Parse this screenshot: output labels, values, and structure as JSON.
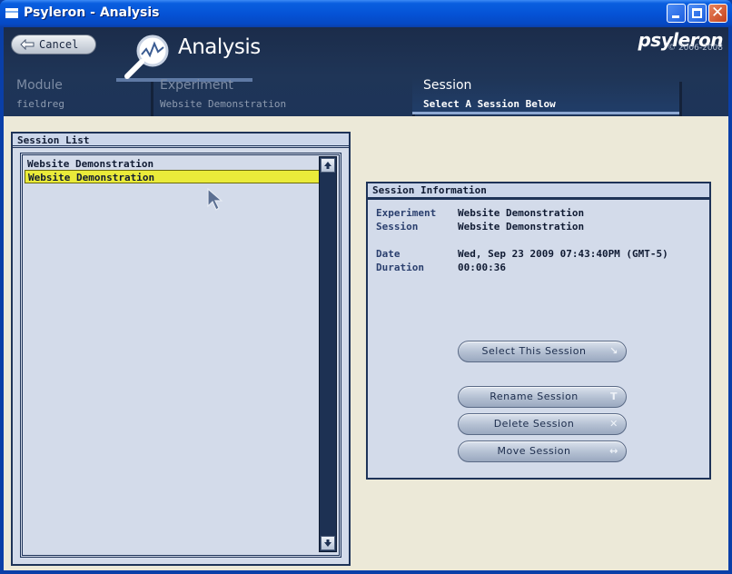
{
  "window": {
    "title": "Psyleron - Analysis"
  },
  "header": {
    "cancel_label": "Cancel",
    "title": "Analysis",
    "brand": "psyleron",
    "copyright": "© 2006-2008"
  },
  "breadcrumbs": [
    {
      "name": "Module",
      "value": "fieldreg"
    },
    {
      "name": "Experiment",
      "value": "Website Demonstration"
    },
    {
      "name": "Session",
      "value": "Select A Session Below"
    }
  ],
  "session_list": {
    "title": "Session List",
    "items": [
      {
        "label": "Website Demonstration",
        "selected": false
      },
      {
        "label": "Website Demonstration",
        "selected": true
      }
    ]
  },
  "session_info": {
    "title": "Session Information",
    "fields": [
      {
        "key": "Experiment",
        "value": "Website Demonstration"
      },
      {
        "key": "Session",
        "value": "Website Demonstration"
      },
      {
        "key": "Date",
        "value": "Wed, Sep 23 2009 07:43:40PM (GMT-5)"
      },
      {
        "key": "Duration",
        "value": "00:00:36"
      }
    ],
    "buttons": {
      "select": {
        "label": "Select This Session",
        "icon": "arrow-corner-icon"
      },
      "rename": {
        "label": "Rename Session",
        "icon": "text-t-icon"
      },
      "delete": {
        "label": "Delete Session",
        "icon": "x-icon"
      },
      "move": {
        "label": "Move Session",
        "icon": "double-arrow-icon"
      }
    }
  },
  "colors": {
    "header_bg": "#1f3557",
    "panel_bg": "#d3dbea",
    "selection": "#eaeb3a",
    "window_bg": "#ece9d8"
  }
}
